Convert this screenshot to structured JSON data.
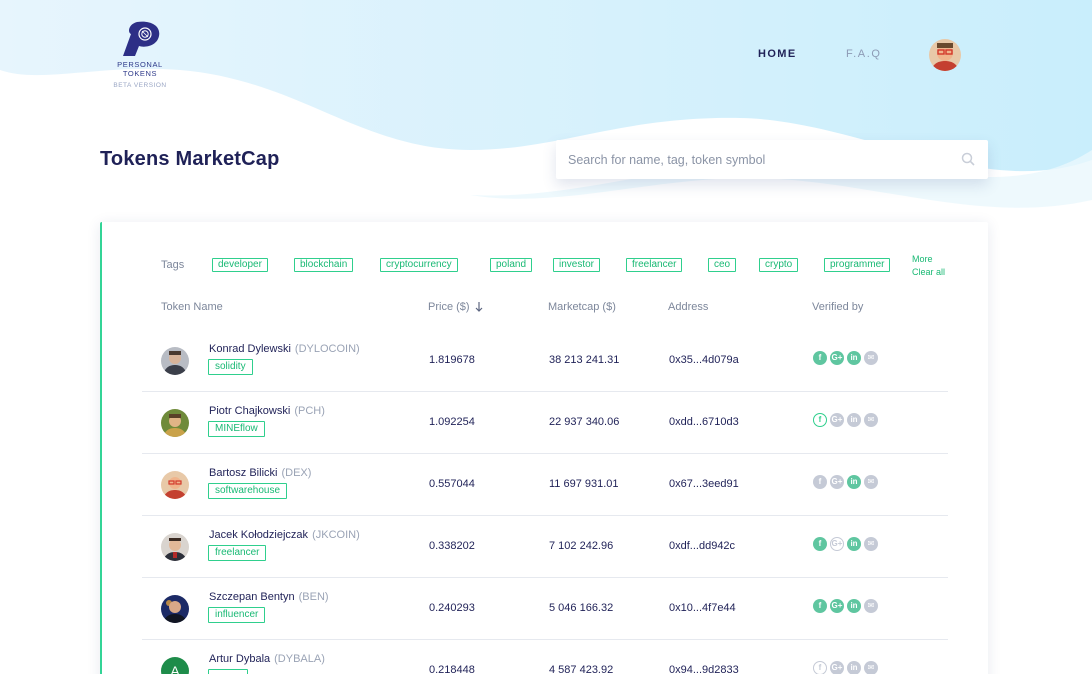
{
  "header": {
    "logo_name": "PERSONAL TOKENS",
    "logo_beta": "BETA VERSION",
    "nav": {
      "home": "HOME",
      "faq": "F.A.Q"
    }
  },
  "page": {
    "title": "Tokens MarketCap"
  },
  "search": {
    "placeholder": "Search for name, tag, token symbol"
  },
  "tags": {
    "label": "Tags",
    "items": [
      "developer",
      "blockchain",
      "cryptocurrency",
      "poland",
      "investor",
      "freelancer",
      "ceo",
      "crypto",
      "programmer"
    ],
    "more": "More",
    "clear": "Clear all"
  },
  "table": {
    "headers": {
      "name": "Token Name",
      "price": "Price ($)",
      "marketcap": "Marketcap ($)",
      "address": "Address",
      "verified": "Verified by"
    },
    "rows": [
      {
        "name": "Konrad Dylewski",
        "symbol": "(DYLOCOIN)",
        "tag": "solidity",
        "price": "1.819678",
        "marketcap": "38 213 241.31",
        "address": "0x35...4d079a",
        "verified": [
          "on",
          "on",
          "on",
          "off"
        ]
      },
      {
        "name": "Piotr Chajkowski",
        "symbol": "(PCH)",
        "tag": "MINEflow",
        "price": "1.092254",
        "marketcap": "22 937 340.06",
        "address": "0xdd...6710d3",
        "verified": [
          "outline",
          "off",
          "off",
          "off"
        ]
      },
      {
        "name": "Bartosz Bilicki",
        "symbol": "(DEX)",
        "tag": "softwarehouse",
        "price": "0.557044",
        "marketcap": "11 697 931.01",
        "address": "0x67...3eed91",
        "verified": [
          "off",
          "off",
          "on",
          "off"
        ]
      },
      {
        "name": "Jacek Kołodziejczak",
        "symbol": "(JKCOIN)",
        "tag": "freelancer",
        "price": "0.338202",
        "marketcap": "7 102 242.96",
        "address": "0xdf...dd942c",
        "verified": [
          "on",
          "outline-off",
          "on",
          "off"
        ]
      },
      {
        "name": "Szczepan Bentyn",
        "symbol": "(BEN)",
        "tag": "influencer",
        "price": "0.240293",
        "marketcap": "5 046 166.32",
        "address": "0x10...4f7e44",
        "verified": [
          "on",
          "on",
          "on",
          "off"
        ]
      },
      {
        "name": "Artur Dybala",
        "symbol": "(DYBALA)",
        "tag": "",
        "price": "0.218448",
        "marketcap": "4 587 423.92",
        "address": "0x94...9d2833",
        "verified": [
          "outline-off",
          "off",
          "off",
          "off"
        ]
      }
    ]
  },
  "colors": {
    "accent": "#2fcf8d",
    "navy": "#1f2157",
    "muted": "#7d879b",
    "wave": "#dff4fd"
  }
}
